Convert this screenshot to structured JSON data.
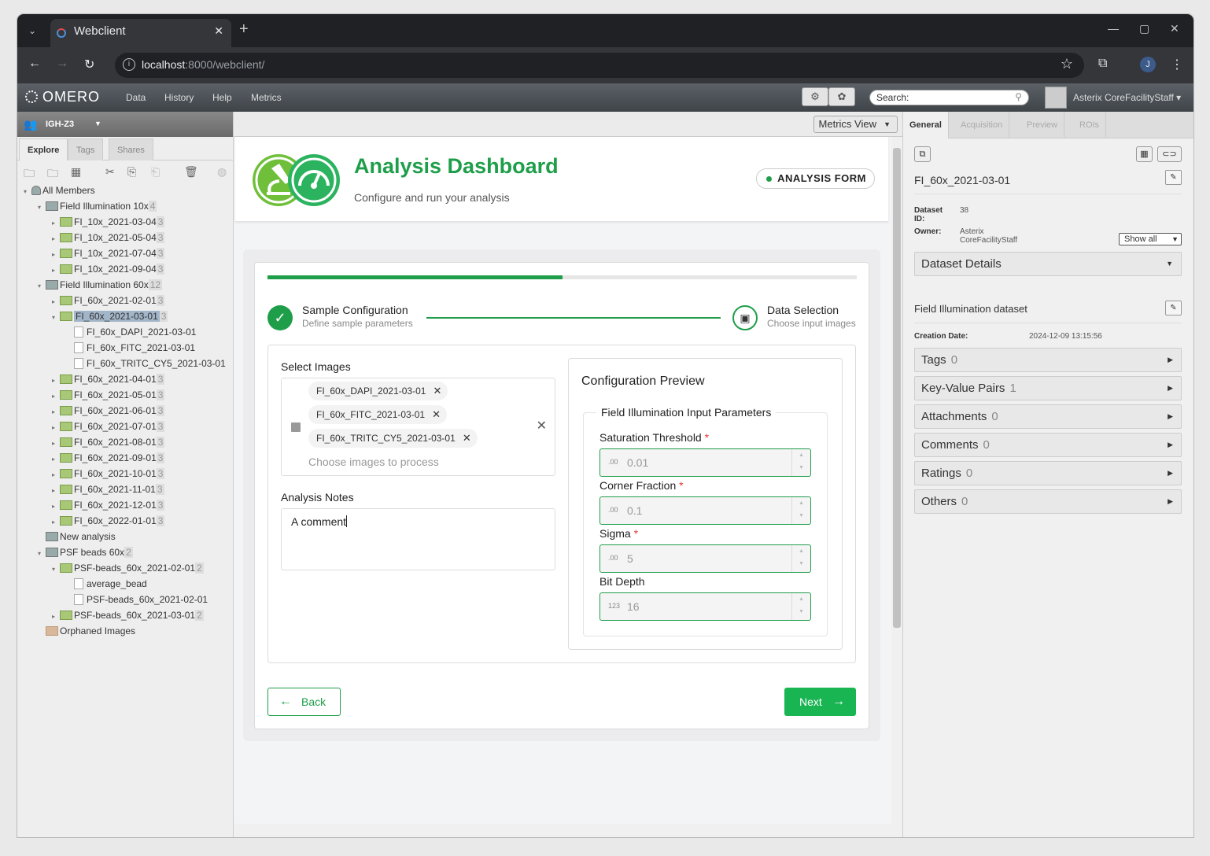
{
  "browser": {
    "tab_title": "Webclient",
    "url_host": "localhost",
    "url_path": ":8000/webclient/",
    "profile_initial": "J"
  },
  "omero": {
    "logo": "OMERO",
    "menu": [
      "Data",
      "History",
      "Help",
      "Metrics"
    ],
    "search_placeholder": "Search:",
    "user": "Asterix CoreFacilityStaff"
  },
  "left": {
    "group": "IGH-Z3",
    "tabs": [
      "Explore",
      "Tags",
      "Shares"
    ],
    "tree": [
      {
        "label": "All Members",
        "count": "",
        "level": 0,
        "kind": "members",
        "arrow": "▾"
      },
      {
        "label": "Field Illumination 10x",
        "count": "4",
        "level": 1,
        "kind": "project",
        "arrow": "▾"
      },
      {
        "label": "FI_10x_2021-03-04",
        "count": "3",
        "level": 2,
        "kind": "dataset",
        "arrow": "▸"
      },
      {
        "label": "FI_10x_2021-05-04",
        "count": "3",
        "level": 2,
        "kind": "dataset",
        "arrow": "▸"
      },
      {
        "label": "FI_10x_2021-07-04",
        "count": "3",
        "level": 2,
        "kind": "dataset",
        "arrow": "▸"
      },
      {
        "label": "FI_10x_2021-09-04",
        "count": "3",
        "level": 2,
        "kind": "dataset",
        "arrow": "▸"
      },
      {
        "label": "Field Illumination 60x",
        "count": "12",
        "level": 1,
        "kind": "project",
        "arrow": "▾"
      },
      {
        "label": "FI_60x_2021-02-01",
        "count": "3",
        "level": 2,
        "kind": "dataset",
        "arrow": "▸"
      },
      {
        "label": "FI_60x_2021-03-01",
        "count": "3",
        "level": 2,
        "kind": "dataset",
        "arrow": "▾",
        "selected": true
      },
      {
        "label": "FI_60x_DAPI_2021-03-01",
        "count": "",
        "level": 3,
        "kind": "image",
        "arrow": ""
      },
      {
        "label": "FI_60x_FITC_2021-03-01",
        "count": "",
        "level": 3,
        "kind": "image",
        "arrow": ""
      },
      {
        "label": "FI_60x_TRITC_CY5_2021-03-01",
        "count": "",
        "level": 3,
        "kind": "image",
        "arrow": ""
      },
      {
        "label": "FI_60x_2021-04-01",
        "count": "3",
        "level": 2,
        "kind": "dataset",
        "arrow": "▸"
      },
      {
        "label": "FI_60x_2021-05-01",
        "count": "3",
        "level": 2,
        "kind": "dataset",
        "arrow": "▸"
      },
      {
        "label": "FI_60x_2021-06-01",
        "count": "3",
        "level": 2,
        "kind": "dataset",
        "arrow": "▸"
      },
      {
        "label": "FI_60x_2021-07-01",
        "count": "3",
        "level": 2,
        "kind": "dataset",
        "arrow": "▸"
      },
      {
        "label": "FI_60x_2021-08-01",
        "count": "3",
        "level": 2,
        "kind": "dataset",
        "arrow": "▸"
      },
      {
        "label": "FI_60x_2021-09-01",
        "count": "3",
        "level": 2,
        "kind": "dataset",
        "arrow": "▸"
      },
      {
        "label": "FI_60x_2021-10-01",
        "count": "3",
        "level": 2,
        "kind": "dataset",
        "arrow": "▸"
      },
      {
        "label": "FI_60x_2021-11-01",
        "count": "3",
        "level": 2,
        "kind": "dataset",
        "arrow": "▸"
      },
      {
        "label": "FI_60x_2021-12-01",
        "count": "3",
        "level": 2,
        "kind": "dataset",
        "arrow": "▸"
      },
      {
        "label": "FI_60x_2022-01-01",
        "count": "3",
        "level": 2,
        "kind": "dataset",
        "arrow": "▸"
      },
      {
        "label": "New analysis",
        "count": "",
        "level": 1,
        "kind": "project",
        "arrow": ""
      },
      {
        "label": "PSF beads 60x",
        "count": "2",
        "level": 1,
        "kind": "project",
        "arrow": "▾"
      },
      {
        "label": "PSF-beads_60x_2021-02-01",
        "count": "2",
        "level": 2,
        "kind": "dataset",
        "arrow": "▾"
      },
      {
        "label": "average_bead",
        "count": "",
        "level": 3,
        "kind": "image",
        "arrow": ""
      },
      {
        "label": "PSF-beads_60x_2021-02-01",
        "count": "",
        "level": 3,
        "kind": "image",
        "arrow": ""
      },
      {
        "label": "PSF-beads_60x_2021-03-01",
        "count": "2",
        "level": 2,
        "kind": "dataset",
        "arrow": "▸"
      },
      {
        "label": "Orphaned Images",
        "count": "",
        "level": 1,
        "kind": "orphan",
        "arrow": ""
      }
    ]
  },
  "center": {
    "metrics_view": "Metrics View",
    "title": "Analysis Dashboard",
    "subtitle": "Configure and run your analysis",
    "badge": "ANALYSIS FORM",
    "progress_fraction": 0.5,
    "step1_title": "Sample Configuration",
    "step1_sub": "Define sample parameters",
    "step2_title": "Data Selection",
    "step2_sub": "Choose input images",
    "select_images_label": "Select Images",
    "chips": [
      "FI_60x_DAPI_2021-03-01",
      "FI_60x_FITC_2021-03-01",
      "FI_60x_TRITC_CY5_2021-03-01"
    ],
    "select_placeholder": "Choose images to process",
    "notes_label": "Analysis Notes",
    "notes_value": "A comment",
    "preview_title": "Configuration Preview",
    "legend": "Field Illumination Input Parameters",
    "params": [
      {
        "label": "Saturation Threshold",
        "required": true,
        "prefix": ".00",
        "value": "0.01"
      },
      {
        "label": "Corner Fraction",
        "required": true,
        "prefix": ".00",
        "value": "0.1"
      },
      {
        "label": "Sigma",
        "required": true,
        "prefix": ".00",
        "value": "5"
      },
      {
        "label": "Bit Depth",
        "required": false,
        "prefix": "123",
        "value": "16"
      }
    ],
    "back": "Back",
    "next": "Next"
  },
  "right": {
    "tabs": [
      "General",
      "Acquisition",
      "Preview",
      "ROIs"
    ],
    "dataset_name": "FI_60x_2021-03-01",
    "dataset_id_label": "Dataset ID:",
    "dataset_id": "38",
    "owner_label": "Owner:",
    "owner": "Asterix CoreFacilityStaff",
    "show_all": "Show all",
    "details": "Dataset Details",
    "description": "Field Illumination dataset",
    "creation_label": "Creation Date:",
    "creation_date": "2024-12-09 13:15:56",
    "sections": [
      {
        "label": "Tags",
        "count": "0"
      },
      {
        "label": "Key-Value Pairs",
        "count": "1"
      },
      {
        "label": "Attachments",
        "count": "0"
      },
      {
        "label": "Comments",
        "count": "0"
      },
      {
        "label": "Ratings",
        "count": "0"
      },
      {
        "label": "Others",
        "count": "0"
      }
    ]
  },
  "colors": {
    "accent": "#1f9e4a",
    "next_button": "#19b553",
    "selection": "#a3b6c9"
  }
}
